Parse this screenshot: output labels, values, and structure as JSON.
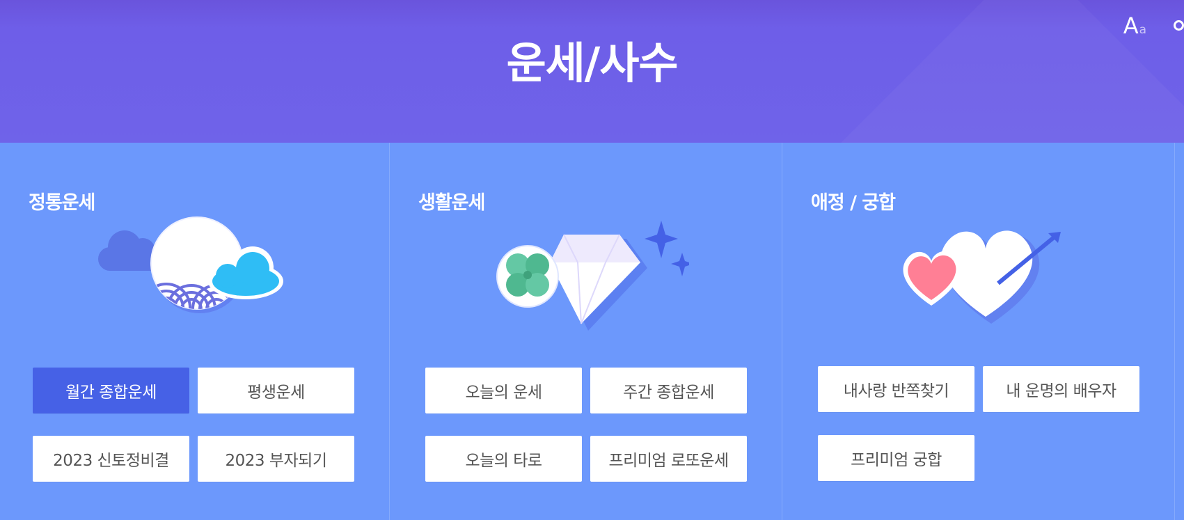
{
  "header": {
    "title": "운세/사수",
    "font_tool": {
      "big": "A",
      "small": "a"
    }
  },
  "sections": [
    {
      "title": "정통운세",
      "icon": "moon-cloud-wave-icon",
      "buttons": [
        {
          "label": "월간 종합운세",
          "active": true
        },
        {
          "label": "평생운세",
          "active": false
        },
        {
          "label": "2023 신토정비결",
          "active": false
        },
        {
          "label": "2023 부자되기",
          "active": false
        }
      ]
    },
    {
      "title": "생활운세",
      "icon": "clover-diamond-icon",
      "buttons": [
        {
          "label": "오늘의 운세",
          "active": false
        },
        {
          "label": "주간 종합운세",
          "active": false
        },
        {
          "label": "오늘의 타로",
          "active": false
        },
        {
          "label": "프리미엄 로또운세",
          "active": false
        }
      ]
    },
    {
      "title": "애정 / 궁합",
      "icon": "hearts-arrow-icon",
      "buttons": [
        {
          "label": "내사랑 반쪽찾기",
          "active": false
        },
        {
          "label": "내 운명의 배우자",
          "active": false
        },
        {
          "label": "프리미엄 궁합",
          "active": false
        }
      ]
    }
  ],
  "colors": {
    "header_bg": "#6f63e9",
    "content_bg": "#6c98fc",
    "active_button": "#4661e6",
    "button_text": "#555555"
  }
}
